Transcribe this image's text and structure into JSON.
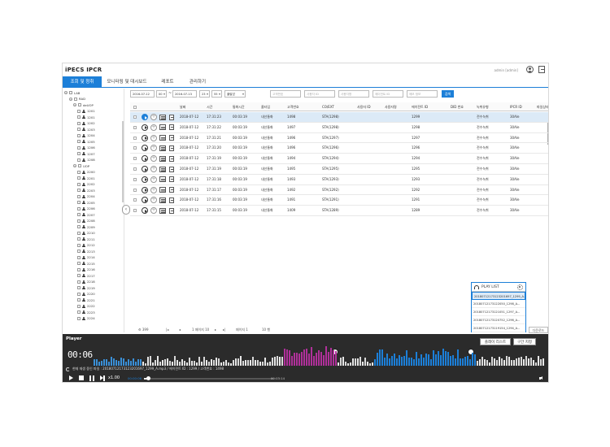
{
  "header": {
    "app_title": "iPECS IPCR",
    "user_label": "admin [admin]"
  },
  "nav": {
    "tabs": [
      {
        "label": "조회 및 청취",
        "active": true
      },
      {
        "label": "모니터링 및 대시보드",
        "active": false
      },
      {
        "label": "레포트",
        "active": false
      },
      {
        "label": "관리하기",
        "active": false
      }
    ]
  },
  "tree": {
    "nodes": [
      {
        "label": "LAB",
        "type": "root"
      },
      {
        "label": "RAD",
        "type": "group"
      },
      {
        "label": "deUOP",
        "type": "group"
      },
      {
        "label": "1201",
        "type": "user"
      },
      {
        "label": "1201",
        "type": "user"
      },
      {
        "label": "1202",
        "type": "user"
      },
      {
        "label": "1203",
        "type": "user"
      },
      {
        "label": "1204",
        "type": "user"
      },
      {
        "label": "1205",
        "type": "user"
      },
      {
        "label": "1206",
        "type": "user"
      },
      {
        "label": "1207",
        "type": "user"
      },
      {
        "label": "1208",
        "type": "user"
      },
      {
        "label": "UOP",
        "type": "group"
      },
      {
        "label": "2200",
        "type": "user"
      },
      {
        "label": "2201",
        "type": "user"
      },
      {
        "label": "2202",
        "type": "user"
      },
      {
        "label": "2203",
        "type": "user"
      },
      {
        "label": "2204",
        "type": "user"
      },
      {
        "label": "2205",
        "type": "user"
      },
      {
        "label": "2206",
        "type": "user"
      },
      {
        "label": "2207",
        "type": "user"
      },
      {
        "label": "2208",
        "type": "user"
      },
      {
        "label": "2209",
        "type": "user"
      },
      {
        "label": "2210",
        "type": "user"
      },
      {
        "label": "2211",
        "type": "user"
      },
      {
        "label": "2212",
        "type": "user"
      },
      {
        "label": "2213",
        "type": "user"
      },
      {
        "label": "2214",
        "type": "user"
      },
      {
        "label": "2215",
        "type": "user"
      },
      {
        "label": "2216",
        "type": "user"
      },
      {
        "label": "2217",
        "type": "user"
      },
      {
        "label": "2218",
        "type": "user"
      },
      {
        "label": "2219",
        "type": "user"
      },
      {
        "label": "2220",
        "type": "user"
      },
      {
        "label": "2221",
        "type": "user"
      },
      {
        "label": "2222",
        "type": "user"
      },
      {
        "label": "2223",
        "type": "user"
      },
      {
        "label": "2224",
        "type": "user"
      }
    ]
  },
  "search": {
    "start_date": "2016-07-12",
    "start_hour": "00",
    "end_date": "2016-07-13",
    "end_hour": "23",
    "end_min": "55",
    "call_type": "출발압",
    "ph_customer": "고객번호",
    "ph_user_id": "사용자 ID",
    "ph_user_name": "사용자명",
    "ph_agent_id": "에이전트 ID",
    "ph_memo": "메모 정보",
    "search_label": "검색"
  },
  "table": {
    "columns": [
      "날짜",
      "시간",
      "통화시간",
      "콜타입",
      "고객번호",
      "CO/EXT",
      "사용자 ID",
      "사용자명",
      "에이전트 ID",
      "DID 번호",
      "녹취유형",
      "IPCR ID",
      "파일상태"
    ],
    "rows": [
      {
        "date": "2018-07-12",
        "time": "17:31:23",
        "dur": "00:03:19",
        "type": "내선통화",
        "cust": "1498",
        "coext": "STA(1298)",
        "agent": "1299",
        "rec": "전수녹취",
        "ipcr": "30Ale",
        "selected": true
      },
      {
        "date": "2018-07-12",
        "time": "17:31:22",
        "dur": "00:03:19",
        "type": "내선통화",
        "cust": "1497",
        "coext": "STA(1298)",
        "agent": "1298",
        "rec": "전수녹취",
        "ipcr": "30Ale",
        "selected": false
      },
      {
        "date": "2018-07-12",
        "time": "17:31:21",
        "dur": "00:03:19",
        "type": "내선통화",
        "cust": "1496",
        "coext": "STA(1297)",
        "agent": "1297",
        "rec": "전수녹취",
        "ipcr": "30Ale",
        "selected": false
      },
      {
        "date": "2018-07-12",
        "time": "17:31:20",
        "dur": "00:03:19",
        "type": "내선통화",
        "cust": "1496",
        "coext": "STA(1296)",
        "agent": "1296",
        "rec": "전수녹취",
        "ipcr": "30Ale",
        "selected": false
      },
      {
        "date": "2018-07-12",
        "time": "17:31:19",
        "dur": "00:03:19",
        "type": "내선통화",
        "cust": "1494",
        "coext": "STA(1294)",
        "agent": "1294",
        "rec": "전수녹취",
        "ipcr": "30Ale",
        "selected": false
      },
      {
        "date": "2018-07-12",
        "time": "17:31:19",
        "dur": "00:03:19",
        "type": "내선통화",
        "cust": "1495",
        "coext": "STA(1295)",
        "agent": "1295",
        "rec": "전수녹취",
        "ipcr": "30Ale",
        "selected": false
      },
      {
        "date": "2018-07-12",
        "time": "17:31:18",
        "dur": "00:03:19",
        "type": "내선통화",
        "cust": "1493",
        "coext": "STA(1293)",
        "agent": "1293",
        "rec": "전수녹취",
        "ipcr": "30Ale",
        "selected": false
      },
      {
        "date": "2018-07-12",
        "time": "17:31:17",
        "dur": "00:03:19",
        "type": "내선통화",
        "cust": "1492",
        "coext": "STA(1292)",
        "agent": "1292",
        "rec": "전수녹취",
        "ipcr": "30Ale",
        "selected": false
      },
      {
        "date": "2018-07-12",
        "time": "17:31:16",
        "dur": "00:03:19",
        "type": "내선통화",
        "cust": "1491",
        "coext": "STA(1291)",
        "agent": "1291",
        "rec": "전수녹취",
        "ipcr": "30Ale",
        "selected": false
      },
      {
        "date": "2018-07-12",
        "time": "17:31:15",
        "dur": "00:03:19",
        "type": "내선통화",
        "cust": "1409",
        "coext": "STA(1289)",
        "agent": "1289",
        "rec": "전수녹취",
        "ipcr": "30Ale",
        "selected": false
      }
    ]
  },
  "pager": {
    "total": "399",
    "page_info": "1 페이지 10",
    "per_page": "페이지 1",
    "rows_per": "10 행",
    "download_label": "다운로드"
  },
  "playlist": {
    "title": "PLAY LIST",
    "items": [
      {
        "label": "20180712173123201697_1299_A...",
        "selected": true
      },
      {
        "label": "20180712173122050_1298_A...",
        "selected": false
      },
      {
        "label": "20180712173121051_1297_A...",
        "selected": false
      },
      {
        "label": "20180712173120752_1296_A...",
        "selected": false
      },
      {
        "label": "20180712173119154_1294_A...",
        "selected": false
      }
    ]
  },
  "player": {
    "title": "Player",
    "time": "00:06",
    "playlist_btn": "플레이 리스트",
    "range_btn": "구간 지정",
    "info": "현재 재생 중인 파일 : 20180712173123201697_1299_A.mp3 / 에이전트 ID : 1299 / 고객번호 : 1498",
    "speed": "x1.00",
    "cur_time": "00:00:06",
    "end_time": "00:03:14",
    "progress": 0.03,
    "colors": {
      "wave": "#3a8fd6",
      "segment1": "#b0309a",
      "segment2": "#1c7fd8",
      "accent": "#1c7fd8"
    }
  }
}
